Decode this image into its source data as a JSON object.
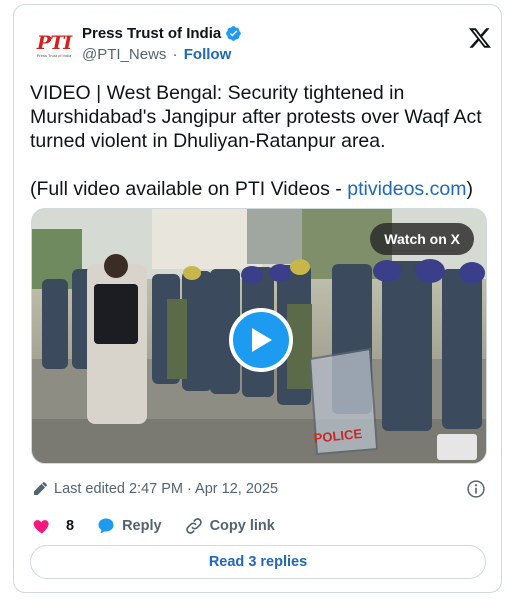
{
  "author": {
    "avatar_logo": "PTI",
    "avatar_subtitle": "Press Trust of India",
    "display_name": "Press Trust of India",
    "handle": "@PTI_News",
    "separator": "·",
    "follow_label": "Follow",
    "verified": true
  },
  "platform_icon": "x-logo-icon",
  "tweet": {
    "line1": "VIDEO | West Bengal: Security tightened in Murshidabad's Jangipur after protests over Waqf Act turned violent in Dhuliyan-Ratanpur area.",
    "line2_prefix": "(Full video available on PTI Videos - ",
    "line2_link": "ptivideos.com",
    "line2_suffix": ")"
  },
  "media": {
    "watch_label": "Watch on X",
    "shield_text": "POLICE",
    "play_icon": "play-icon"
  },
  "meta": {
    "edited_label": "Last edited 2:47 PM · Apr 12, 2025",
    "info_icon": "info-icon"
  },
  "actions": {
    "like_count": "8",
    "reply_label": "Reply",
    "copy_label": "Copy link"
  },
  "replies_button": "Read 3 replies",
  "colors": {
    "link_blue": "#1d69b8",
    "verified_blue": "#1d9bf0",
    "like_pink": "#f91880",
    "muted": "#536471",
    "border": "#cfd9de"
  }
}
